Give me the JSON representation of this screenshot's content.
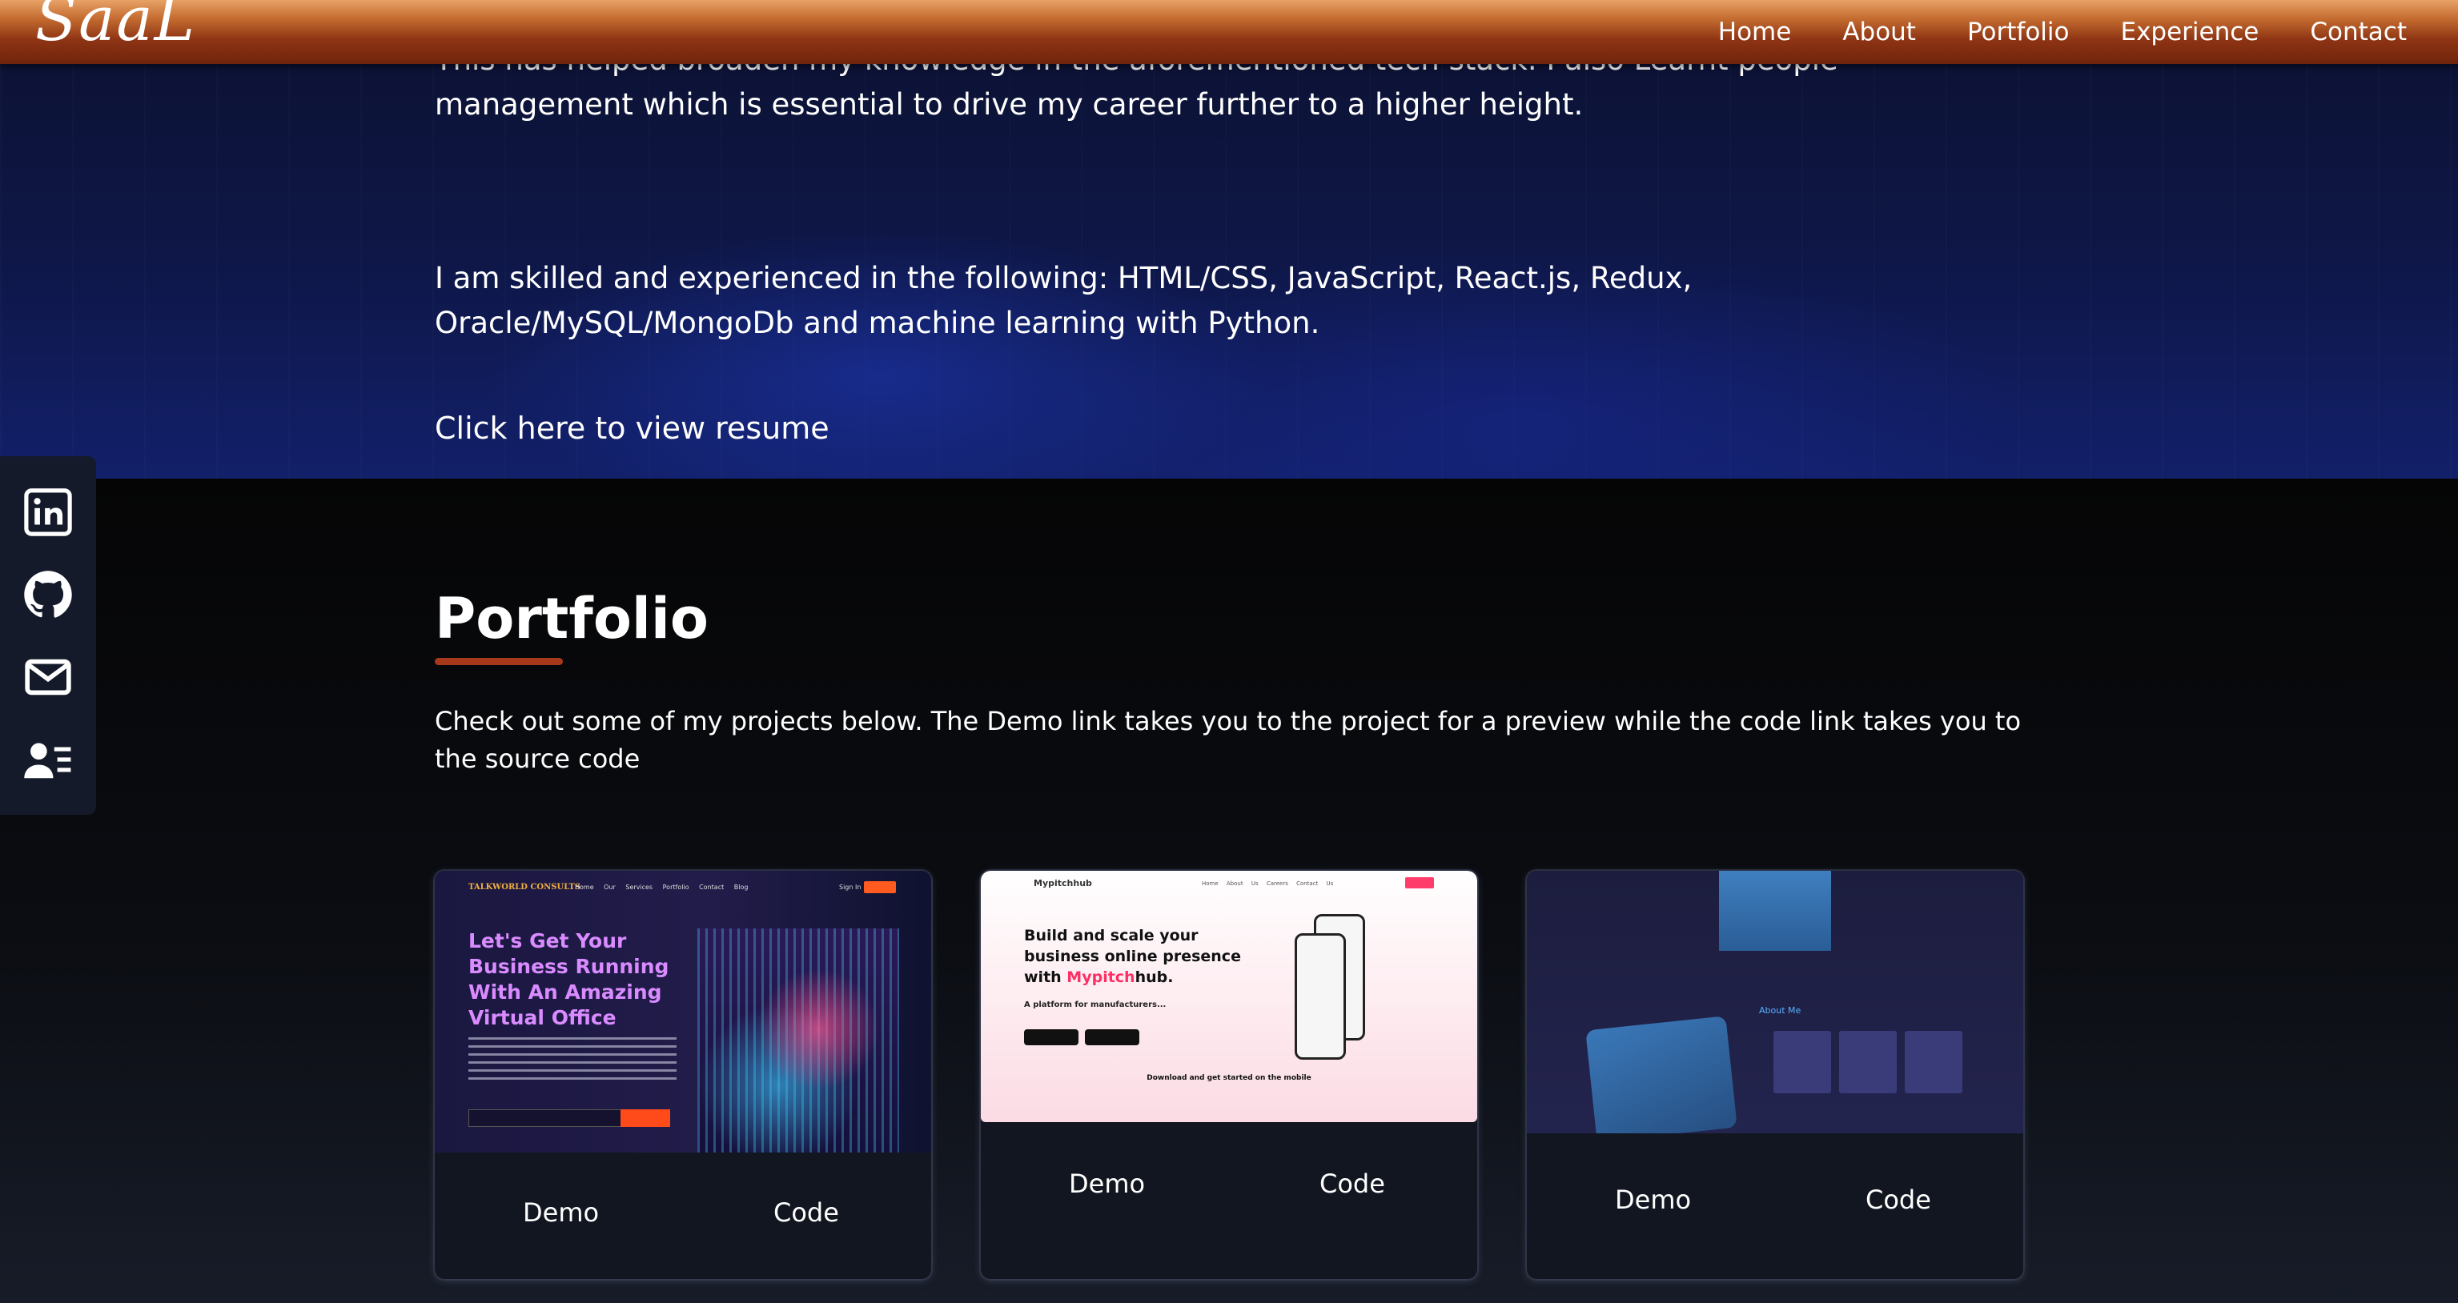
{
  "brand": {
    "logo_text": "SaaL"
  },
  "nav": {
    "items": [
      "Home",
      "About",
      "Portfolio",
      "Experience",
      "Contact"
    ]
  },
  "about": {
    "paragraph_1": "This has helped broaden my knowledge in the aforementioned tech stack. I also Learnt people management which is essential to drive my career further to a higher height.",
    "paragraph_2": "I am skilled and experienced in the following: HTML/CSS, JavaScript, React.js, Redux, Oracle/MySQL/MongoDb and machine learning with Python.",
    "resume_link": "Click here to view resume"
  },
  "social": {
    "icons": [
      "linkedin-icon",
      "github-icon",
      "mail-icon",
      "resume-icon"
    ]
  },
  "portfolio": {
    "title": "Portfolio",
    "description": "Check out some of my projects below. The Demo link takes you to the project for a preview while the code link takes you to the source code",
    "projects": [
      {
        "demo_label": "Demo",
        "code_label": "Code",
        "preview": {
          "brand": "TALKWORLD CONSULTS",
          "nav": "Home Our Services Portfolio Contact Blog",
          "sign_in": "Sign In",
          "headline": "Let's Get Your Business Running With An Amazing Virtual Office"
        }
      },
      {
        "demo_label": "Demo",
        "code_label": "Code",
        "preview": {
          "brand": "Mypitchhub",
          "nav": "Home About Us Careers Contact Us",
          "headline_part1": "Build and scale your business online presence with ",
          "headline_highlight": "Mypitch",
          "headline_part2": "hub.",
          "sub": "A platform for manufacturers...",
          "footer": "Download and get started on the mobile"
        }
      },
      {
        "demo_label": "Demo",
        "code_label": "Code",
        "preview": {
          "about_label": "About Me"
        }
      }
    ]
  },
  "colors": {
    "header_top": "#e8a266",
    "header_bottom": "#6f240c",
    "accent_underline": "#a8381a",
    "about_bg": "#0e1748",
    "portfolio_bg": "#0b0d12",
    "card_bg": "#121620",
    "sidebar_bg": "#141a2a"
  }
}
